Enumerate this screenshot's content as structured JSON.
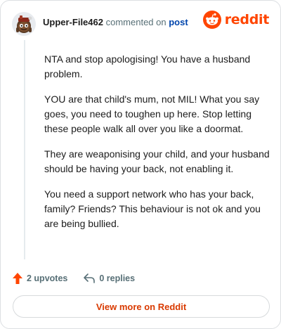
{
  "comment": {
    "username": "Upper-File462",
    "commented_on_text": "commented on",
    "post_link_label": "post",
    "avatar": "snoo-avatar-icon",
    "paragraphs": [
      "NTA and stop apologising! You have a husband problem.",
      "YOU are that child's mum, not MIL! What you say goes, you need to toughen up here. Stop letting these people walk all over you like a doormat.",
      "They are weaponising your child, and your husband should be having your back, not enabling it.",
      "You need a support network who has your back, family? Friends? This behaviour is not ok and you are being bullied."
    ]
  },
  "brand": {
    "name": "reddit",
    "logo_icon": "reddit-snoo-icon",
    "color": "#ff4500"
  },
  "actions": {
    "upvotes_label": "2 upvotes",
    "upvote_icon": "upvote-arrow-icon",
    "upvote_color": "#ff4500",
    "replies_label": "0 replies",
    "reply_icon": "reply-arrow-icon"
  },
  "footer": {
    "view_more_label": "View more on Reddit",
    "accent_color": "#d93a00"
  }
}
